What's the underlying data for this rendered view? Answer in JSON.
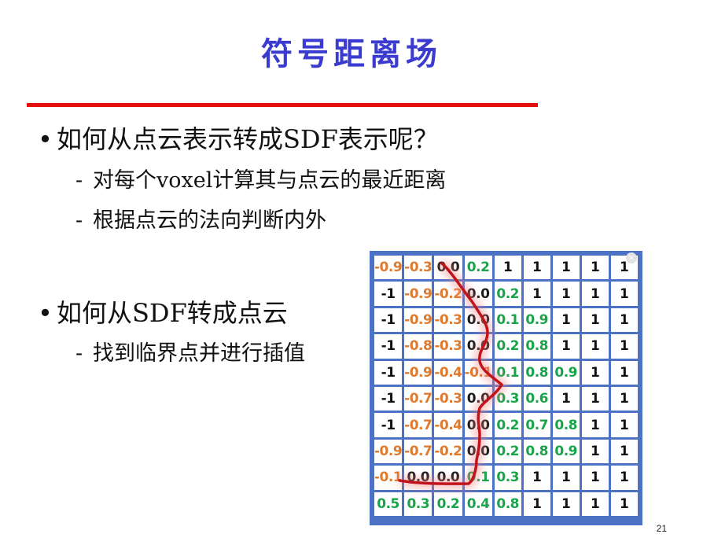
{
  "slide": {
    "title": "符号距离场",
    "page_number": "21"
  },
  "bullets": [
    {
      "text": "如何从点云表示转成SDF表示呢？",
      "subs": [
        "对每个voxel计算其与点云的最近距离",
        "根据点云的法向判断内外"
      ]
    },
    {
      "text": "如何从SDF转成点云",
      "subs": [
        "找到临界点并进行插值"
      ]
    }
  ],
  "sdf_grid": [
    [
      "-0.9",
      "-0.3",
      "0.0",
      "0.2",
      "1",
      "1",
      "1",
      "1",
      "1"
    ],
    [
      "-1",
      "-0.9",
      "-0.2",
      "0.0",
      "0.2",
      "1",
      "1",
      "1",
      "1"
    ],
    [
      "-1",
      "-0.9",
      "-0.3",
      "0.0",
      "0.1",
      "0.9",
      "1",
      "1",
      "1"
    ],
    [
      "-1",
      "-0.8",
      "-0.3",
      "0.0",
      "0.2",
      "0.8",
      "1",
      "1",
      "1"
    ],
    [
      "-1",
      "-0.9",
      "-0.4",
      "-0.1",
      "0.1",
      "0.8",
      "0.9",
      "1",
      "1"
    ],
    [
      "-1",
      "-0.7",
      "-0.3",
      "0.0",
      "0.3",
      "0.6",
      "1",
      "1",
      "1"
    ],
    [
      "-1",
      "-0.7",
      "-0.4",
      "0.0",
      "0.2",
      "0.7",
      "0.8",
      "1",
      "1"
    ],
    [
      "-0.9",
      "-0.7",
      "-0.2",
      "0.0",
      "0.2",
      "0.8",
      "0.9",
      "1",
      "1"
    ],
    [
      "-0.1",
      "0.0",
      "0.0",
      "0.1",
      "0.3",
      "1",
      "1",
      "1",
      "1"
    ],
    [
      "0.5",
      "0.3",
      "0.2",
      "0.4",
      "0.8",
      "1",
      "1",
      "1",
      "1"
    ]
  ],
  "colors": {
    "title": "#3b3bd0",
    "divider": "#e3100c",
    "grid_border": "#4b72c4",
    "negative": "#e07a2c",
    "positive": "#19a34a",
    "surface_curve": "#c0141a"
  },
  "icons": {
    "close": "close-icon"
  }
}
